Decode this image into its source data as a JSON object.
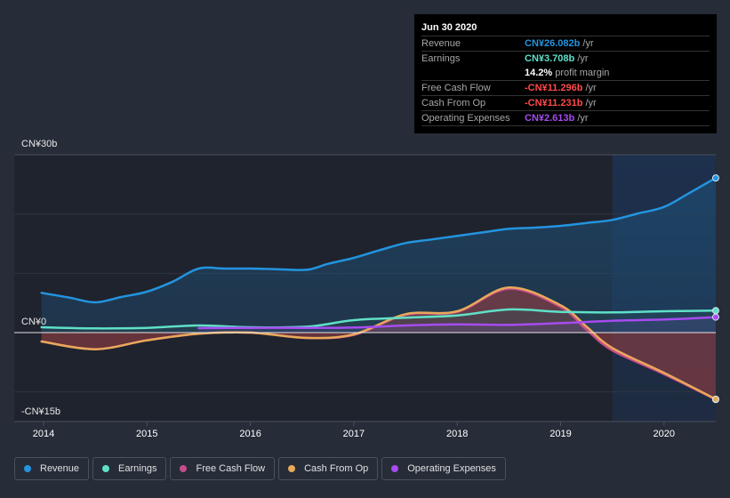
{
  "tooltip": {
    "date": "Jun 30 2020",
    "rows": [
      {
        "label": "Revenue",
        "value": "CN¥26.082b",
        "unit": " /yr",
        "color": "#2394df"
      },
      {
        "label": "Earnings",
        "value": "CN¥3.708b",
        "unit": " /yr",
        "color": "#5fe0c8"
      },
      {
        "label": "",
        "value": "14.2%",
        "unit": " profit margin",
        "color": "#ffffff"
      },
      {
        "label": "Free Cash Flow",
        "value": "-CN¥11.296b",
        "unit": " /yr",
        "color": "#ff4a4a"
      },
      {
        "label": "Cash From Op",
        "value": "-CN¥11.231b",
        "unit": " /yr",
        "color": "#ff4a4a"
      },
      {
        "label": "Operating Expenses",
        "value": "CN¥2.613b",
        "unit": " /yr",
        "color": "#a64cf0"
      }
    ]
  },
  "legend": [
    {
      "label": "Revenue",
      "color": "#2394df"
    },
    {
      "label": "Earnings",
      "color": "#5fe0c8"
    },
    {
      "label": "Free Cash Flow",
      "color": "#c84b8a"
    },
    {
      "label": "Cash From Op",
      "color": "#e8a95a"
    },
    {
      "label": "Operating Expenses",
      "color": "#a64cf0"
    }
  ],
  "chart_data": {
    "type": "area",
    "title": "",
    "xlabel": "",
    "ylabel": "",
    "currency": "CN¥",
    "ylim": [
      -15,
      30
    ],
    "xlim": [
      2013.98,
      2020.5
    ],
    "y_tick_labels": [
      {
        "value": 30,
        "label": "CN¥30b"
      },
      {
        "value": 0,
        "label": "CN¥0"
      },
      {
        "value": -15,
        "label": "-CN¥15b"
      }
    ],
    "x_tick_labels": [
      "2014",
      "2015",
      "2016",
      "2017",
      "2018",
      "2019",
      "2020"
    ],
    "x_ticks": [
      2014,
      2015,
      2016,
      2017,
      2018,
      2019,
      2020
    ],
    "forecast_highlight_start": 2019.5,
    "grid": true,
    "legend_position": "bottom-left",
    "series": [
      {
        "name": "Revenue",
        "color": "#2394df",
        "points": [
          [
            2013.98,
            6.7
          ],
          [
            2014.25,
            5.9
          ],
          [
            2014.5,
            5.1
          ],
          [
            2014.75,
            6.0
          ],
          [
            2015,
            6.9
          ],
          [
            2015.25,
            8.6
          ],
          [
            2015.5,
            10.8
          ],
          [
            2015.75,
            10.8
          ],
          [
            2016,
            10.8
          ],
          [
            2016.25,
            10.7
          ],
          [
            2016.55,
            10.6
          ],
          [
            2016.75,
            11.6
          ],
          [
            2017,
            12.6
          ],
          [
            2017.25,
            13.9
          ],
          [
            2017.5,
            15.1
          ],
          [
            2017.75,
            15.7
          ],
          [
            2018,
            16.3
          ],
          [
            2018.25,
            16.9
          ],
          [
            2018.5,
            17.5
          ],
          [
            2018.75,
            17.7
          ],
          [
            2019,
            18.0
          ],
          [
            2019.25,
            18.5
          ],
          [
            2019.5,
            19.0
          ],
          [
            2019.75,
            20.1
          ],
          [
            2020,
            21.2
          ],
          [
            2020.25,
            23.6
          ],
          [
            2020.5,
            26.082
          ]
        ]
      },
      {
        "name": "Earnings",
        "color": "#5fe0c8",
        "points": [
          [
            2013.98,
            0.9
          ],
          [
            2014.5,
            0.7
          ],
          [
            2015,
            0.8
          ],
          [
            2015.5,
            1.2
          ],
          [
            2016,
            0.9
          ],
          [
            2016.55,
            1.0
          ],
          [
            2017,
            2.1
          ],
          [
            2017.5,
            2.5
          ],
          [
            2018,
            2.9
          ],
          [
            2018.5,
            3.9
          ],
          [
            2019,
            3.5
          ],
          [
            2019.5,
            3.4
          ],
          [
            2020,
            3.6
          ],
          [
            2020.5,
            3.708
          ]
        ]
      },
      {
        "name": "Free Cash Flow",
        "color": "#c84b8a",
        "points": [
          [
            2013.98,
            -1.5
          ],
          [
            2014.5,
            -2.8
          ],
          [
            2015,
            -1.3
          ],
          [
            2015.5,
            -0.2
          ],
          [
            2016,
            0.0
          ],
          [
            2016.55,
            -0.9
          ],
          [
            2017,
            -0.4
          ],
          [
            2017.5,
            3.0
          ],
          [
            2018,
            3.5
          ],
          [
            2018.5,
            7.4
          ],
          [
            2019,
            4.3
          ],
          [
            2019.25,
            0.5
          ],
          [
            2019.5,
            -3.0
          ],
          [
            2020,
            -7.0
          ],
          [
            2020.5,
            -11.296
          ]
        ]
      },
      {
        "name": "Cash From Op",
        "color": "#e8a95a",
        "points": [
          [
            2013.98,
            -1.5
          ],
          [
            2014.5,
            -2.8
          ],
          [
            2015,
            -1.3
          ],
          [
            2015.5,
            -0.2
          ],
          [
            2016,
            0.0
          ],
          [
            2016.55,
            -0.9
          ],
          [
            2017,
            -0.3
          ],
          [
            2017.5,
            3.1
          ],
          [
            2018,
            3.6
          ],
          [
            2018.5,
            7.6
          ],
          [
            2019,
            4.6
          ],
          [
            2019.25,
            1.0
          ],
          [
            2019.5,
            -2.6
          ],
          [
            2020,
            -6.8
          ],
          [
            2020.5,
            -11.231
          ]
        ]
      },
      {
        "name": "Operating Expenses",
        "color": "#a64cf0",
        "points": [
          [
            2015.5,
            0.75
          ],
          [
            2016,
            0.8
          ],
          [
            2016.55,
            0.8
          ],
          [
            2017,
            0.85
          ],
          [
            2017.5,
            1.2
          ],
          [
            2018,
            1.4
          ],
          [
            2018.5,
            1.3
          ],
          [
            2019,
            1.6
          ],
          [
            2019.5,
            2.0
          ],
          [
            2020,
            2.2
          ],
          [
            2020.5,
            2.613
          ]
        ]
      }
    ]
  }
}
